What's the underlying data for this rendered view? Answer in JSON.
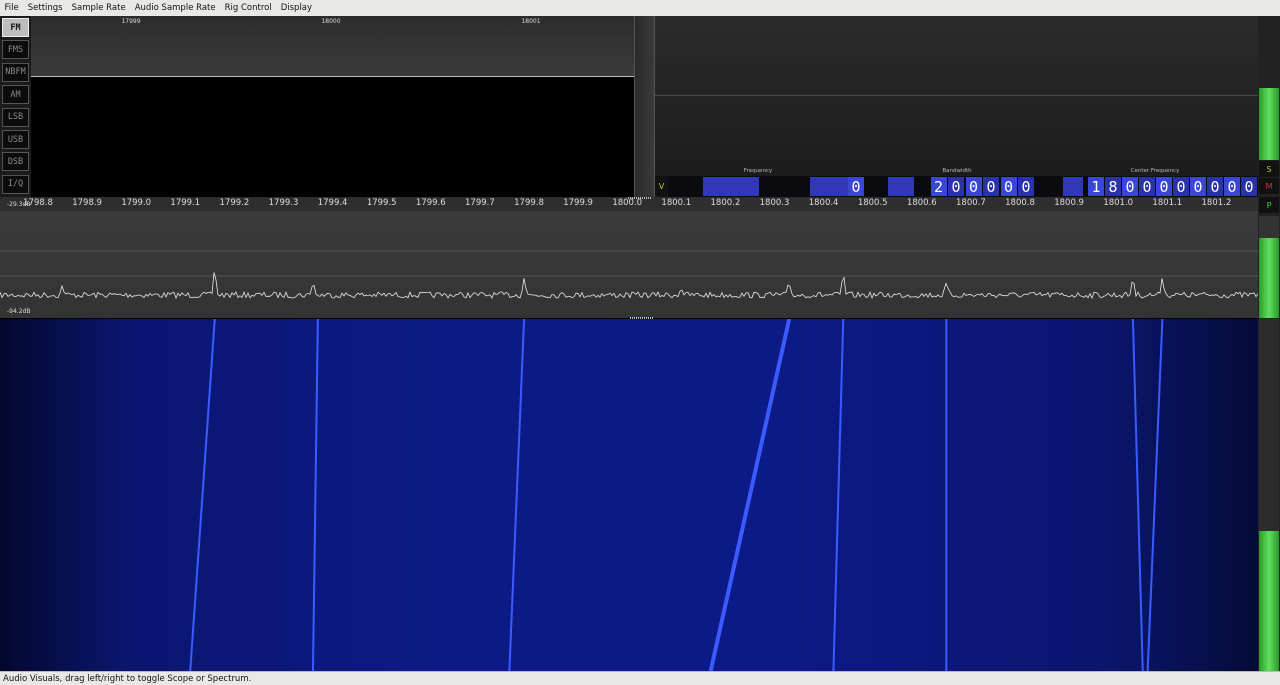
{
  "menu": [
    "File",
    "Settings",
    "Sample Rate",
    "Audio Sample Rate",
    "Rig Control",
    "Display"
  ],
  "modes": [
    {
      "label": "FM",
      "active": true
    },
    {
      "label": "FMS",
      "active": false
    },
    {
      "label": "NBFM",
      "active": false
    },
    {
      "label": "AM",
      "active": false
    },
    {
      "label": "LSB",
      "active": false
    },
    {
      "label": "USB",
      "active": false
    },
    {
      "label": "DSB",
      "active": false
    },
    {
      "label": "I/Q",
      "active": false
    }
  ],
  "audio_ticks": [
    "17999",
    "18000",
    "18001"
  ],
  "digits": {
    "v_label": "V",
    "frequency_label": "Frequency",
    "bandwidth_label": "Bandwidth",
    "center_label": "Center Frequency",
    "frequency_value": "0",
    "bandwidth_value": "200000",
    "center_value": "1800000000"
  },
  "side_buttons": {
    "s": "S",
    "m": "M",
    "p": "P"
  },
  "spectrum": {
    "top_db": "-29.3dB",
    "bottom_db": "-94.2dB",
    "ticks": [
      "1798.8",
      "1798.9",
      "1799.0",
      "1799.1",
      "1799.2",
      "1799.3",
      "1799.4",
      "1799.5",
      "1799.6",
      "1799.7",
      "1799.8",
      "1799.9",
      "1800.0",
      "1800.1",
      "1800.2",
      "1800.3",
      "1800.4",
      "1800.5",
      "1800.6",
      "1800.7",
      "1800.8",
      "1800.9",
      "1801.0",
      "1801.1",
      "1801.2"
    ],
    "peaks": [
      {
        "x": 1798.85,
        "h": 0.35
      },
      {
        "x": 1799.16,
        "h": 1.0
      },
      {
        "x": 1799.36,
        "h": 0.55
      },
      {
        "x": 1799.79,
        "h": 0.65
      },
      {
        "x": 1800.11,
        "h": 0.3
      },
      {
        "x": 1800.33,
        "h": 0.45
      },
      {
        "x": 1800.44,
        "h": 0.75
      },
      {
        "x": 1800.65,
        "h": 0.4
      },
      {
        "x": 1801.03,
        "h": 0.7
      },
      {
        "x": 1801.09,
        "h": 0.72
      }
    ]
  },
  "waterfall": {
    "signals": [
      {
        "top": 1799.16,
        "bottom": 1799.11
      },
      {
        "top": 1799.37,
        "bottom": 1799.36
      },
      {
        "top": 1799.79,
        "bottom": 1799.76
      },
      {
        "top": 1800.33,
        "bottom": 1800.17
      },
      {
        "top": 1800.44,
        "bottom": 1800.42
      },
      {
        "top": 1800.65,
        "bottom": 1800.65
      },
      {
        "top": 1801.03,
        "bottom": 1801.05
      },
      {
        "top": 1801.09,
        "bottom": 1801.06
      }
    ]
  },
  "status": "Audio Visuals, drag left/right to toggle Scope or Spectrum."
}
